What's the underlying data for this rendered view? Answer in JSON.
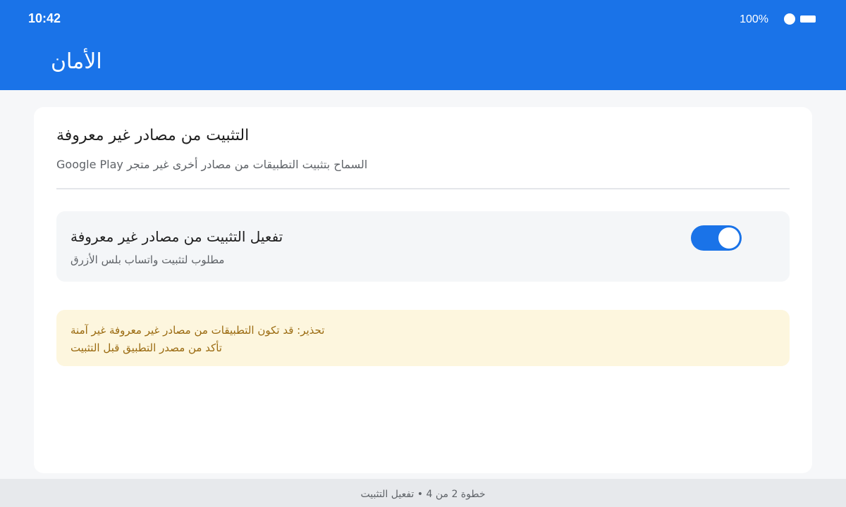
{
  "status_bar": {
    "time": "10:42",
    "battery_percent": "100%",
    "icons": [
      "status-dot-icon",
      "battery-icon"
    ]
  },
  "app_bar": {
    "title": "الأمان"
  },
  "section": {
    "title": "التثبيت من مصادر غير معروفة",
    "description": "السماح بتثبيت التطبيقات من مصادر أخرى غير متجر Google Play"
  },
  "toggle": {
    "label": "تفعيل التثبيت من مصادر غير معروفة",
    "sublabel": "مطلوب لتثبيت واتساب بلس الأزرق",
    "state": "on"
  },
  "warning": {
    "line1": "تحذير: قد تكون التطبيقات من مصادر غير معروفة غير آمنة",
    "line2": "تأكد من مصدر التطبيق قبل التثبيت"
  },
  "footer": {
    "text": "خطوة 2 من 4 • تفعيل التثبيت"
  },
  "colors": {
    "primary": "#1a73e8",
    "warning_bg": "#fdf6de",
    "warning_text": "#9a6a10"
  }
}
